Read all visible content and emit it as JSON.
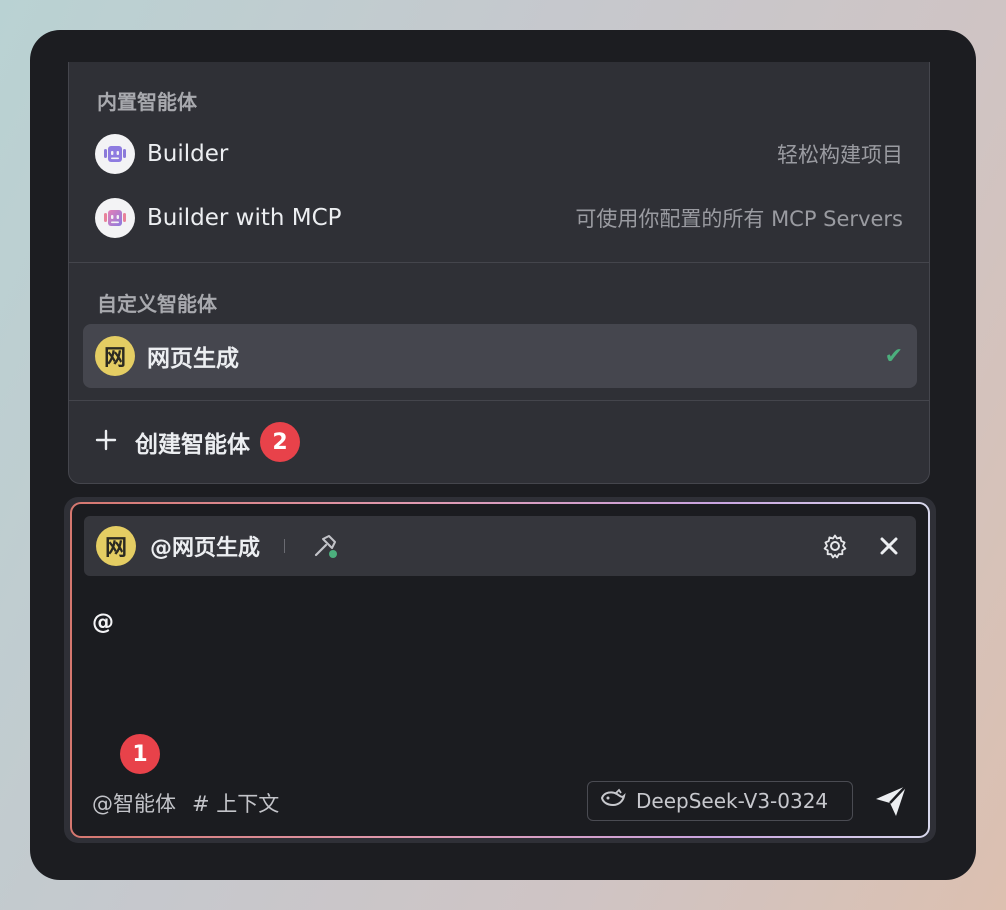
{
  "dropdown": {
    "builtin_title": "内置智能体",
    "builtin_agents": [
      {
        "name": "Builder",
        "description": "轻松构建项目",
        "icon": "robot-icon"
      },
      {
        "name": "Builder with MCP",
        "description": "可使用你配置的所有 MCP Servers",
        "icon": "robot-mcp-icon"
      }
    ],
    "custom_title": "自定义智能体",
    "custom_agents": [
      {
        "avatar_char": "网",
        "name": "网页生成",
        "selected": true
      }
    ],
    "create_label": "创建智能体",
    "create_badge": "2"
  },
  "input": {
    "agent_avatar_char": "网",
    "agent_mention": "@网页生成",
    "typed_text": "@",
    "badge": "1",
    "agent_link": "@智能体",
    "context_link": "# 上下文",
    "model_label": "DeepSeek-V3-0324"
  },
  "colors": {
    "accent_badge": "#e8424a",
    "check_green": "#4caf7d",
    "avatar_yellow": "#e4cd63"
  }
}
